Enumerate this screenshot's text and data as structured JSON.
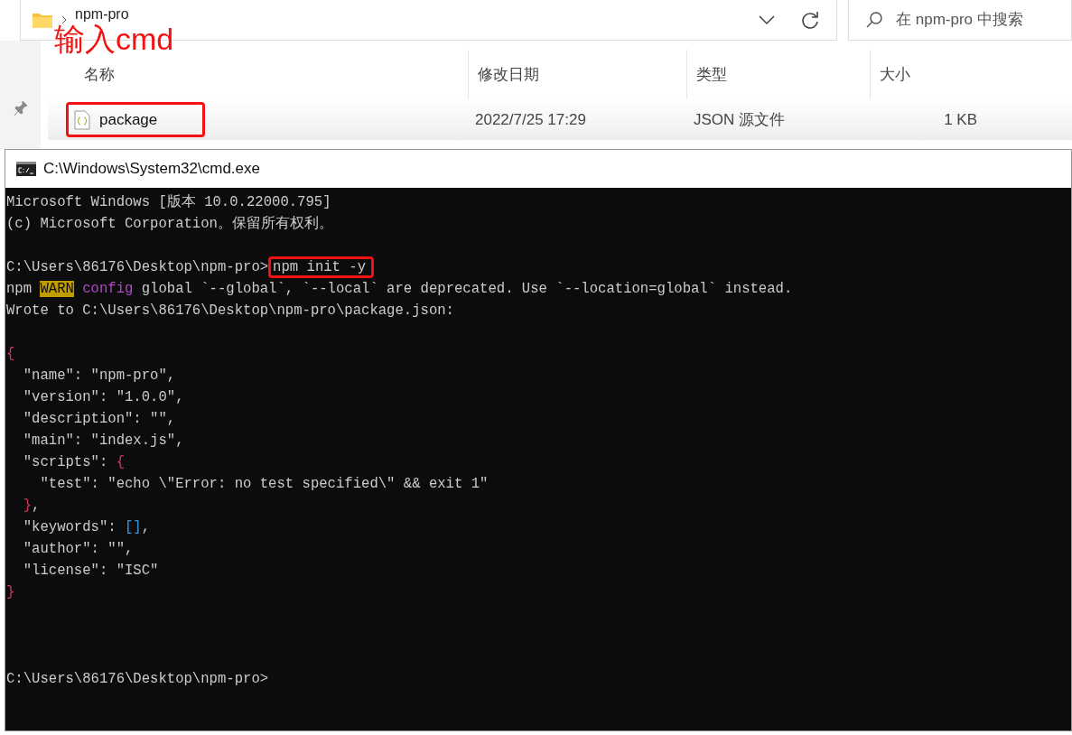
{
  "explorer": {
    "breadcrumb": "npm-pro",
    "search": {
      "placeholder": "在 npm-pro 中搜索"
    },
    "columns": [
      "名称",
      "修改日期",
      "类型",
      "大小"
    ],
    "files": [
      {
        "name": "package",
        "modified": "2022/7/25 17:29",
        "type": "JSON 源文件",
        "size": "1 KB",
        "highlighted": true
      }
    ]
  },
  "annotation": "输入cmd",
  "console": {
    "title": "C:\\Windows\\System32\\cmd.exe",
    "lines": [
      {
        "kind": "text",
        "segments": [
          {
            "text": "Microsoft Windows [版本 10.0.22000.795]",
            "kind": "plain"
          }
        ]
      },
      {
        "kind": "text",
        "segments": [
          {
            "text": "(c) Microsoft Corporation。保留所有权利。",
            "kind": "plain"
          }
        ]
      },
      {
        "kind": "blank"
      },
      {
        "kind": "command",
        "prompt": "C:\\Users\\86176\\Desktop\\npm-pro>",
        "command": "npm init -y",
        "highlighted": true
      },
      {
        "kind": "text",
        "segments": [
          {
            "text": "npm ",
            "kind": "plain"
          },
          {
            "text": "WARN",
            "kind": "warn"
          },
          {
            "text": " config",
            "kind": "keyword"
          },
          {
            "text": " global `--global`, `--local` are deprecated. Use `--location=global` instead.",
            "kind": "plain"
          }
        ]
      },
      {
        "kind": "text",
        "segments": [
          {
            "text": "Wrote to C:\\Users\\86176\\Desktop\\npm-pro\\package.json:",
            "kind": "plain"
          }
        ]
      },
      {
        "kind": "blank"
      },
      {
        "kind": "text",
        "segments": [
          {
            "text": "{",
            "kind": "brace"
          }
        ]
      },
      {
        "kind": "text",
        "segments": [
          {
            "text": "  \"name\": \"npm-pro\",",
            "kind": "plain"
          }
        ]
      },
      {
        "kind": "text",
        "segments": [
          {
            "text": "  \"version\": \"1.0.0\",",
            "kind": "plain"
          }
        ]
      },
      {
        "kind": "text",
        "segments": [
          {
            "text": "  \"description\": \"\",",
            "kind": "plain"
          }
        ]
      },
      {
        "kind": "text",
        "segments": [
          {
            "text": "  \"main\": \"index.js\",",
            "kind": "plain"
          }
        ]
      },
      {
        "kind": "text",
        "segments": [
          {
            "text": "  \"scripts\": ",
            "kind": "plain"
          },
          {
            "text": "{",
            "kind": "brace"
          }
        ]
      },
      {
        "kind": "text",
        "segments": [
          {
            "text": "    \"test\": \"echo \\\"Error: no test specified\\\" && exit 1\"",
            "kind": "plain"
          }
        ]
      },
      {
        "kind": "text",
        "segments": [
          {
            "text": "  }",
            "kind": "brace"
          },
          {
            "text": ",",
            "kind": "plain"
          }
        ]
      },
      {
        "kind": "text",
        "segments": [
          {
            "text": "  \"keywords\": ",
            "kind": "plain"
          },
          {
            "text": "[]",
            "kind": "bracket"
          },
          {
            "text": ",",
            "kind": "plain"
          }
        ]
      },
      {
        "kind": "text",
        "segments": [
          {
            "text": "  \"author\": \"\",",
            "kind": "plain"
          }
        ]
      },
      {
        "kind": "text",
        "segments": [
          {
            "text": "  \"license\": \"ISC\"",
            "kind": "plain"
          }
        ]
      },
      {
        "kind": "text",
        "segments": [
          {
            "text": "}",
            "kind": "brace"
          }
        ]
      },
      {
        "kind": "blank"
      },
      {
        "kind": "blank"
      },
      {
        "kind": "blank"
      },
      {
        "kind": "command",
        "prompt": "C:\\Users\\86176\\Desktop\\npm-pro>"
      }
    ]
  }
}
